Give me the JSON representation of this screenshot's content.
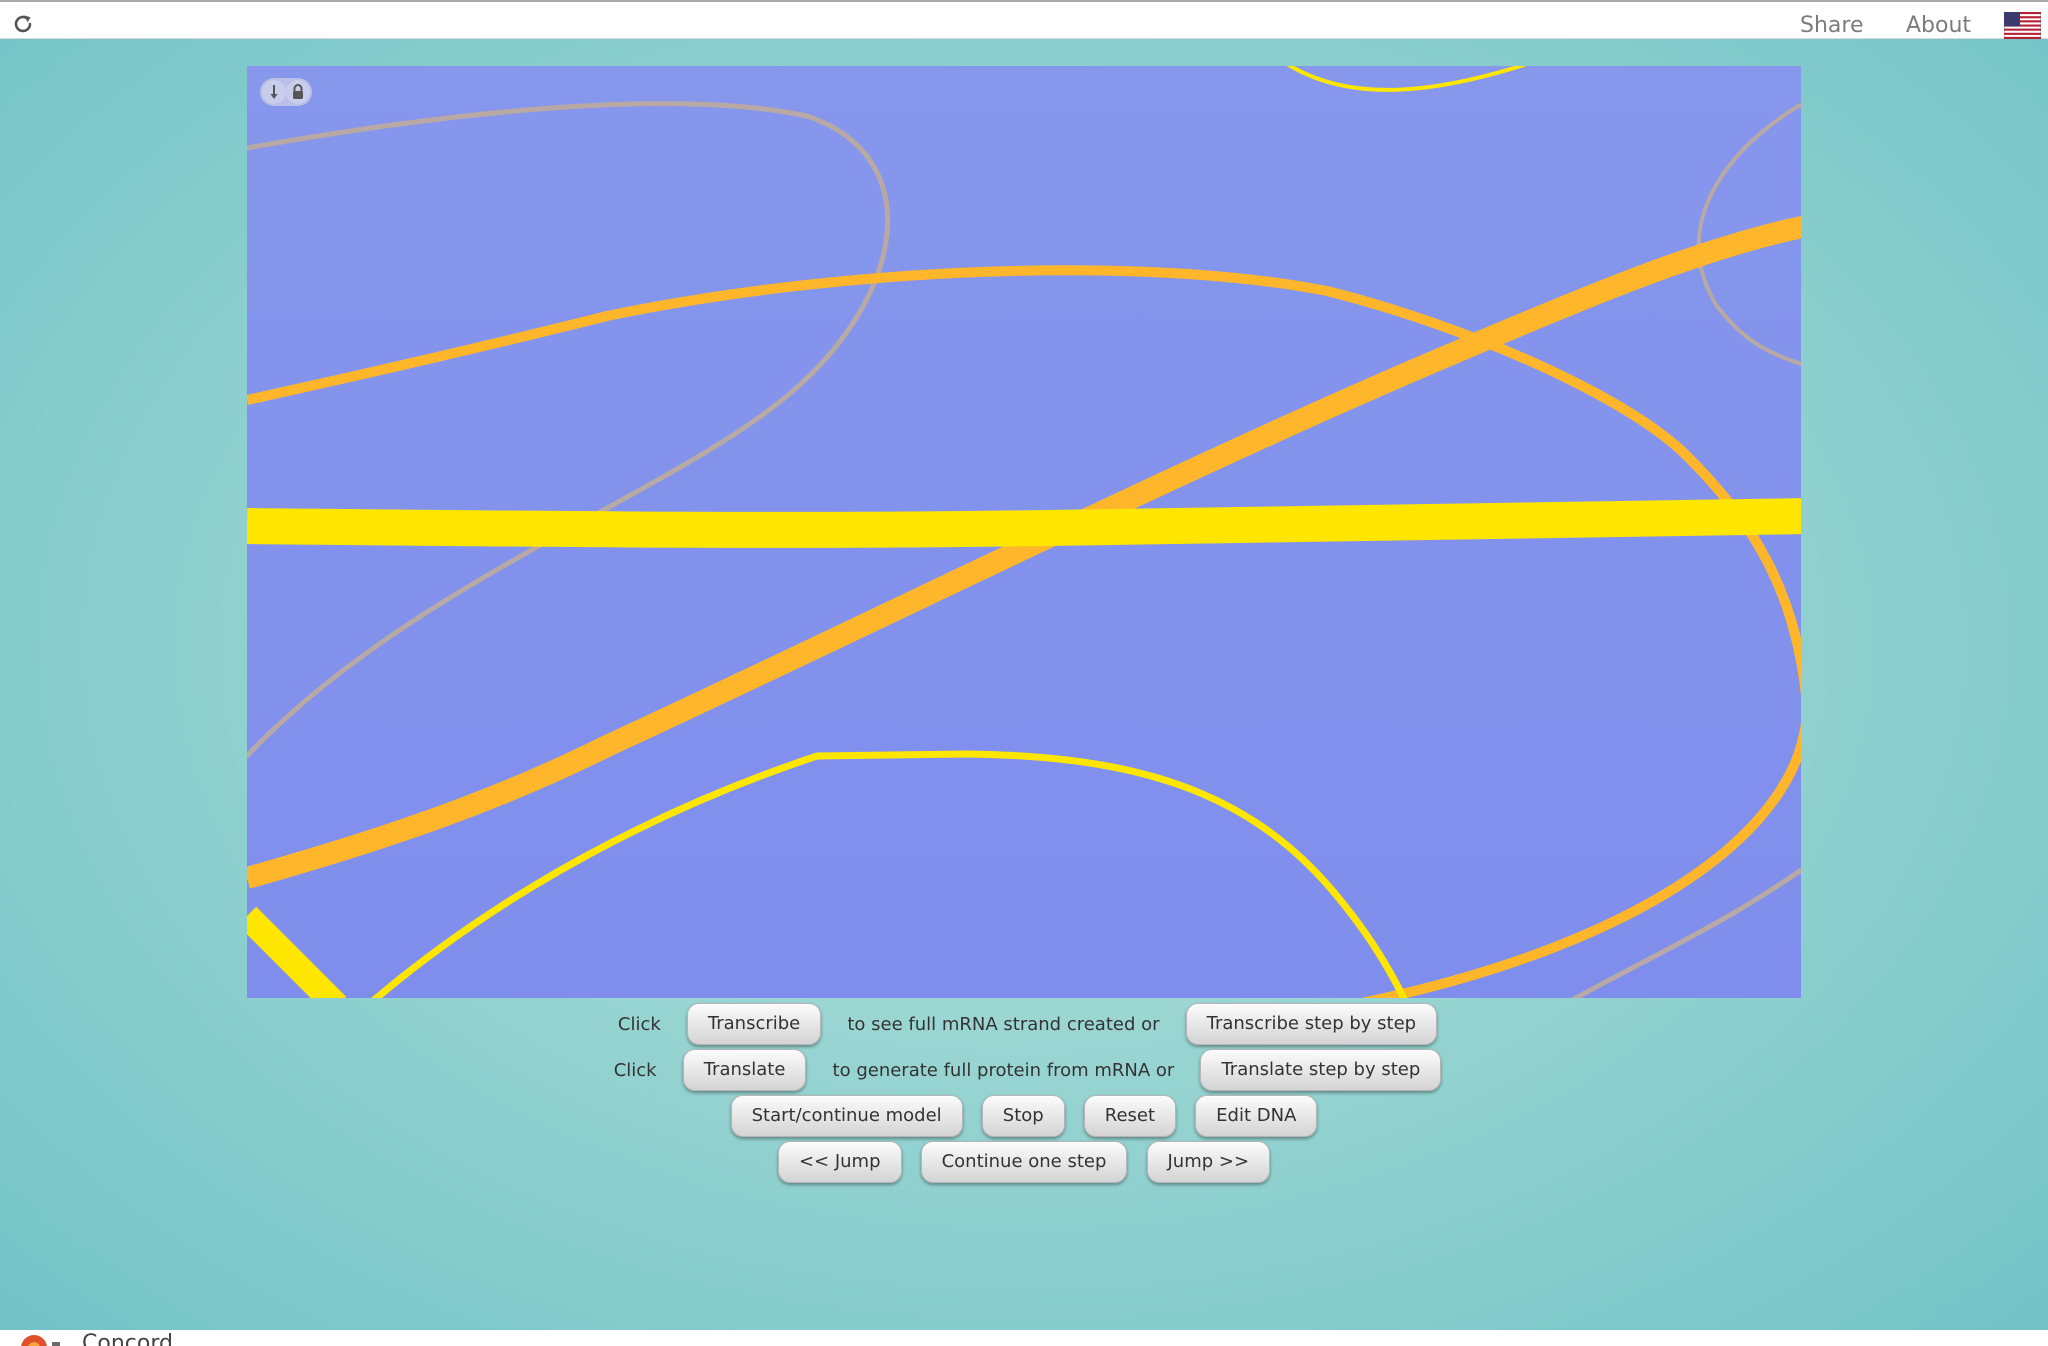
{
  "toolbar": {
    "reload_icon": "reload-icon",
    "share_label": "Share",
    "about_label": "About",
    "language_flag": "us-flag-icon"
  },
  "canvas": {
    "background": "#8594ec",
    "strand_colors": {
      "mrna": "#ffe600",
      "dna": "#ffb62a",
      "faint": "#b9a9a4"
    },
    "lock_toggle_icons": [
      "arrow-down-icon",
      "lock-icon"
    ]
  },
  "controls": {
    "row1": {
      "prefix": "Click",
      "transcribe_label": "Transcribe",
      "middle": "to see full mRNA strand created or",
      "transcribe_step_label": "Transcribe step by step"
    },
    "row2": {
      "prefix": "Click",
      "translate_label": "Translate",
      "middle": "to generate full protein from mRNA or",
      "translate_step_label": "Translate step by step"
    },
    "row3": {
      "start_label": "Start/continue model",
      "stop_label": "Stop",
      "reset_label": "Reset",
      "edit_dna_label": "Edit DNA"
    },
    "row4": {
      "jump_back_label": "<< Jump",
      "continue_step_label": "Continue one step",
      "jump_forward_label": "Jump >>"
    }
  },
  "footer": {
    "text": "Concord"
  }
}
